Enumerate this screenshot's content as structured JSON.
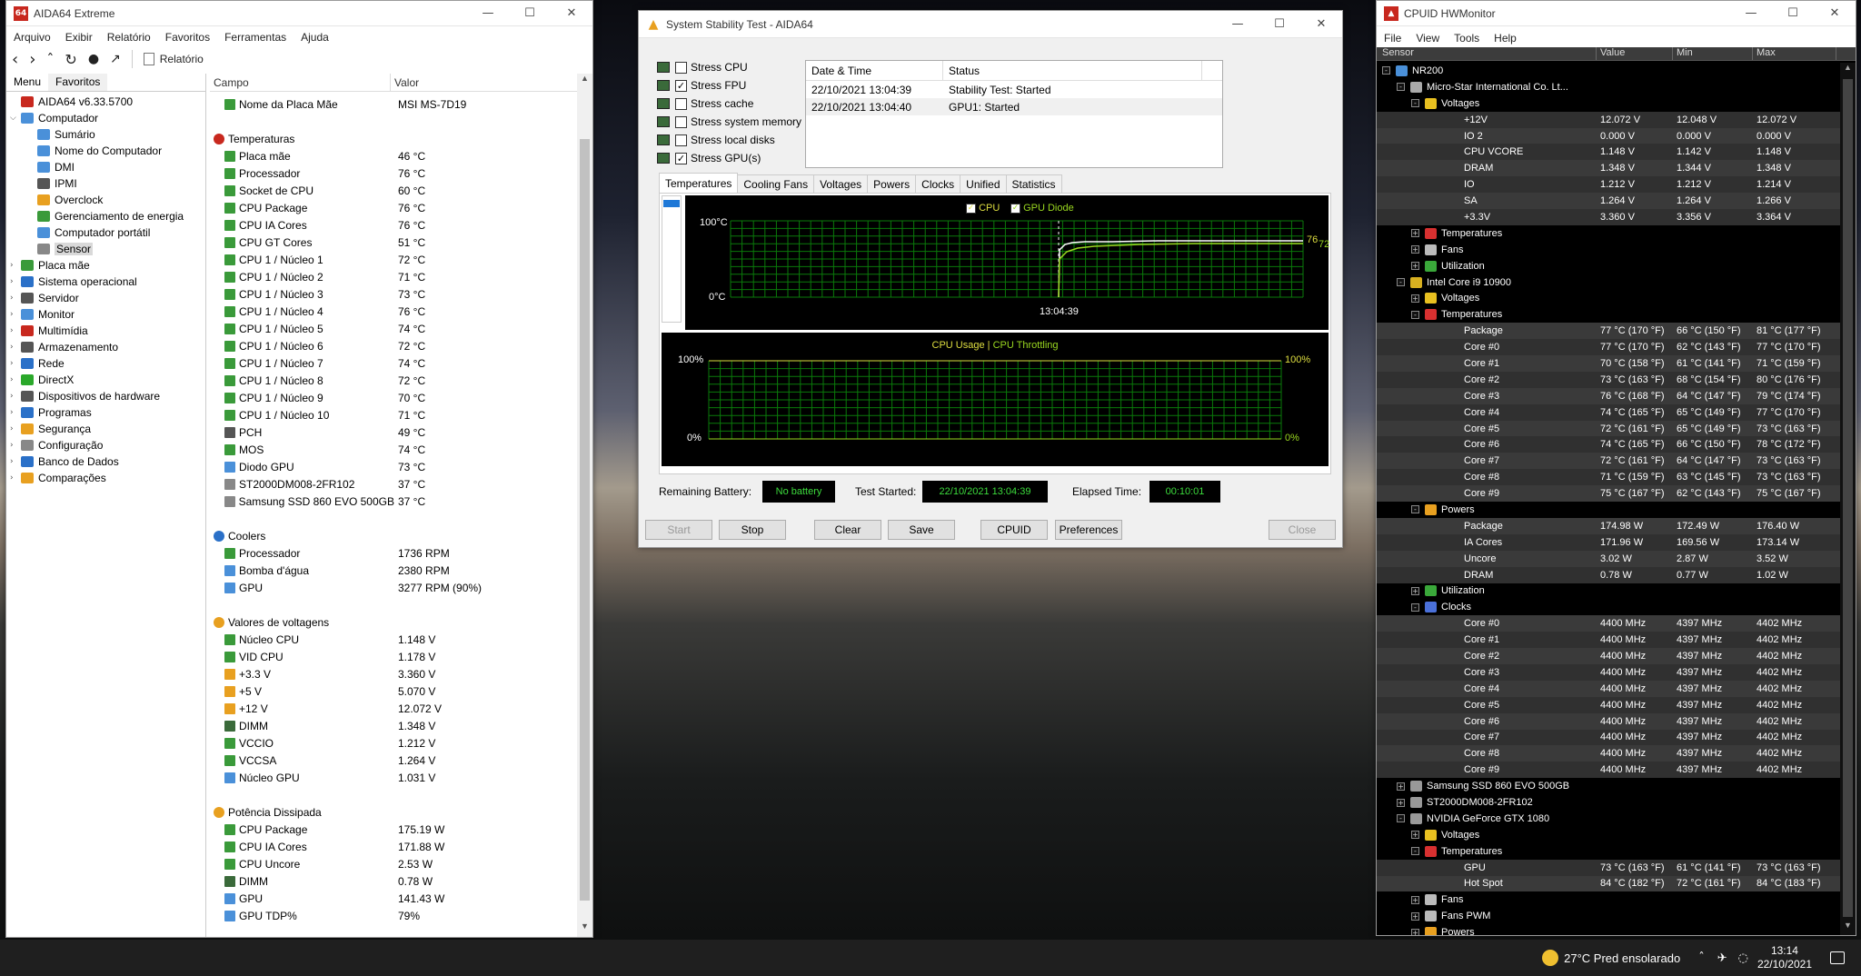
{
  "taskbar": {
    "weather": "27°C  Pred ensolarado",
    "time": "13:14",
    "date": "22/10/2021"
  },
  "aida": {
    "title": "AIDA64 Extreme",
    "menu": [
      "Arquivo",
      "Exibir",
      "Relatório",
      "Favoritos",
      "Ferramentas",
      "Ajuda"
    ],
    "report_label": "Relatório",
    "tabs": [
      "Menu",
      "Favoritos"
    ],
    "tree": [
      {
        "label": "AIDA64 v6.33.5700",
        "lvl": 0,
        "color": "#c8281e"
      },
      {
        "label": "Computador",
        "lvl": 0,
        "color": "#4a90d9",
        "exp": "v"
      },
      {
        "label": "Sumário",
        "lvl": 1,
        "color": "#4a90d9"
      },
      {
        "label": "Nome do Computador",
        "lvl": 1,
        "color": "#4a90d9"
      },
      {
        "label": "DMI",
        "lvl": 1,
        "color": "#4a90d9"
      },
      {
        "label": "IPMI",
        "lvl": 1,
        "color": "#555"
      },
      {
        "label": "Overclock",
        "lvl": 1,
        "color": "#e8a020"
      },
      {
        "label": "Gerenciamento de energia",
        "lvl": 1,
        "color": "#3a9a3a"
      },
      {
        "label": "Computador portátil",
        "lvl": 1,
        "color": "#4a90d9"
      },
      {
        "label": "Sensor",
        "lvl": 1,
        "color": "#888",
        "sel": true
      },
      {
        "label": "Placa mãe",
        "lvl": 0,
        "color": "#3a9a3a",
        "exp": ">"
      },
      {
        "label": "Sistema operacional",
        "lvl": 0,
        "color": "#2a70c8",
        "exp": ">"
      },
      {
        "label": "Servidor",
        "lvl": 0,
        "color": "#555",
        "exp": ">"
      },
      {
        "label": "Monitor",
        "lvl": 0,
        "color": "#4a90d9",
        "exp": ">"
      },
      {
        "label": "Multimídia",
        "lvl": 0,
        "color": "#c8281e",
        "exp": ">"
      },
      {
        "label": "Armazenamento",
        "lvl": 0,
        "color": "#555",
        "exp": ">"
      },
      {
        "label": "Rede",
        "lvl": 0,
        "color": "#2a70c8",
        "exp": ">"
      },
      {
        "label": "DirectX",
        "lvl": 0,
        "color": "#2aa82a",
        "exp": ">"
      },
      {
        "label": "Dispositivos de hardware",
        "lvl": 0,
        "color": "#555",
        "exp": ">"
      },
      {
        "label": "Programas",
        "lvl": 0,
        "color": "#2a70c8",
        "exp": ">"
      },
      {
        "label": "Segurança",
        "lvl": 0,
        "color": "#e8a020",
        "exp": ">"
      },
      {
        "label": "Configuração",
        "lvl": 0,
        "color": "#888",
        "exp": ">"
      },
      {
        "label": "Banco de Dados",
        "lvl": 0,
        "color": "#2a70c8",
        "exp": ">"
      },
      {
        "label": "Comparações",
        "lvl": 0,
        "color": "#e8a020",
        "exp": ">"
      }
    ],
    "cols": [
      "Campo",
      "Valor"
    ],
    "rows": [
      {
        "k": "Nome da Placa Mãe",
        "v": "MSI MS-7D19",
        "t": "i",
        "c": "#3a9a3a"
      },
      {
        "t": "b"
      },
      {
        "k": "Temperaturas",
        "t": "s",
        "c": "#c8281e"
      },
      {
        "k": "Placa mãe",
        "v": "46 °C",
        "t": "i",
        "c": "#3a9a3a"
      },
      {
        "k": "Processador",
        "v": "76 °C",
        "t": "i",
        "c": "#3a9a3a"
      },
      {
        "k": "Socket de CPU",
        "v": "60 °C",
        "t": "i",
        "c": "#3a9a3a"
      },
      {
        "k": "CPU Package",
        "v": "76 °C",
        "t": "i",
        "c": "#3a9a3a"
      },
      {
        "k": "CPU IA Cores",
        "v": "76 °C",
        "t": "i",
        "c": "#3a9a3a"
      },
      {
        "k": "CPU GT Cores",
        "v": "51 °C",
        "t": "i",
        "c": "#3a9a3a"
      },
      {
        "k": "CPU 1 / Núcleo 1",
        "v": "72 °C",
        "t": "i",
        "c": "#3a9a3a"
      },
      {
        "k": "CPU 1 / Núcleo 2",
        "v": "71 °C",
        "t": "i",
        "c": "#3a9a3a"
      },
      {
        "k": "CPU 1 / Núcleo 3",
        "v": "73 °C",
        "t": "i",
        "c": "#3a9a3a"
      },
      {
        "k": "CPU 1 / Núcleo 4",
        "v": "76 °C",
        "t": "i",
        "c": "#3a9a3a"
      },
      {
        "k": "CPU 1 / Núcleo 5",
        "v": "74 °C",
        "t": "i",
        "c": "#3a9a3a"
      },
      {
        "k": "CPU 1 / Núcleo 6",
        "v": "72 °C",
        "t": "i",
        "c": "#3a9a3a"
      },
      {
        "k": "CPU 1 / Núcleo 7",
        "v": "74 °C",
        "t": "i",
        "c": "#3a9a3a"
      },
      {
        "k": "CPU 1 / Núcleo 8",
        "v": "72 °C",
        "t": "i",
        "c": "#3a9a3a"
      },
      {
        "k": "CPU 1 / Núcleo 9",
        "v": "70 °C",
        "t": "i",
        "c": "#3a9a3a"
      },
      {
        "k": "CPU 1 / Núcleo 10",
        "v": "71 °C",
        "t": "i",
        "c": "#3a9a3a"
      },
      {
        "k": "PCH",
        "v": "49 °C",
        "t": "i",
        "c": "#555"
      },
      {
        "k": "MOS",
        "v": "74 °C",
        "t": "i",
        "c": "#3a9a3a"
      },
      {
        "k": "Diodo GPU",
        "v": "73 °C",
        "t": "i",
        "c": "#4a90d9"
      },
      {
        "k": "ST2000DM008-2FR102",
        "v": "37 °C",
        "t": "i",
        "c": "#888"
      },
      {
        "k": "Samsung SSD 860 EVO 500GB",
        "v": "37 °C",
        "t": "i",
        "c": "#888"
      },
      {
        "t": "b"
      },
      {
        "k": "Coolers",
        "t": "s",
        "c": "#2a70c8"
      },
      {
        "k": "Processador",
        "v": "1736 RPM",
        "t": "i",
        "c": "#3a9a3a"
      },
      {
        "k": "Bomba d'água",
        "v": "2380 RPM",
        "t": "i",
        "c": "#4a90d9"
      },
      {
        "k": "GPU",
        "v": "3277 RPM  (90%)",
        "t": "i",
        "c": "#4a90d9"
      },
      {
        "t": "b"
      },
      {
        "k": "Valores de voltagens",
        "t": "s",
        "c": "#e8a020"
      },
      {
        "k": "Núcleo CPU",
        "v": "1.148 V",
        "t": "i",
        "c": "#3a9a3a"
      },
      {
        "k": "VID CPU",
        "v": "1.178 V",
        "t": "i",
        "c": "#3a9a3a"
      },
      {
        "k": "+3.3 V",
        "v": "3.360 V",
        "t": "i",
        "c": "#e8a020"
      },
      {
        "k": "+5 V",
        "v": "5.070 V",
        "t": "i",
        "c": "#e8a020"
      },
      {
        "k": "+12 V",
        "v": "12.072 V",
        "t": "i",
        "c": "#e8a020"
      },
      {
        "k": "DIMM",
        "v": "1.348 V",
        "t": "i",
        "c": "#3a6a3a"
      },
      {
        "k": "VCCIO",
        "v": "1.212 V",
        "t": "i",
        "c": "#3a9a3a"
      },
      {
        "k": "VCCSA",
        "v": "1.264 V",
        "t": "i",
        "c": "#3a9a3a"
      },
      {
        "k": "Núcleo GPU",
        "v": "1.031 V",
        "t": "i",
        "c": "#4a90d9"
      },
      {
        "t": "b"
      },
      {
        "k": "Potência Dissipada",
        "t": "s",
        "c": "#e8a020"
      },
      {
        "k": "CPU Package",
        "v": "175.19 W",
        "t": "i",
        "c": "#3a9a3a"
      },
      {
        "k": "CPU IA Cores",
        "v": "171.88 W",
        "t": "i",
        "c": "#3a9a3a"
      },
      {
        "k": "CPU Uncore",
        "v": "2.53 W",
        "t": "i",
        "c": "#3a9a3a"
      },
      {
        "k": "DIMM",
        "v": "0.78 W",
        "t": "i",
        "c": "#3a6a3a"
      },
      {
        "k": "GPU",
        "v": "141.43 W",
        "t": "i",
        "c": "#4a90d9"
      },
      {
        "k": "GPU TDP%",
        "v": "79%",
        "t": "i",
        "c": "#4a90d9"
      }
    ]
  },
  "sst": {
    "title": "System Stability Test - AIDA64",
    "stress": [
      {
        "label": "Stress CPU",
        "checked": false
      },
      {
        "label": "Stress FPU",
        "checked": true
      },
      {
        "label": "Stress cache",
        "checked": false
      },
      {
        "label": "Stress system memory",
        "checked": false
      },
      {
        "label": "Stress local disks",
        "checked": false
      },
      {
        "label": "Stress GPU(s)",
        "checked": true
      }
    ],
    "log_cols": [
      "Date & Time",
      "Status"
    ],
    "log": [
      {
        "dt": "22/10/2021 13:04:39",
        "st": "Stability Test: Started"
      },
      {
        "dt": "22/10/2021 13:04:40",
        "st": "GPU1: Started"
      }
    ],
    "tabs": [
      "Temperatures",
      "Cooling Fans",
      "Voltages",
      "Powers",
      "Clocks",
      "Unified",
      "Statistics"
    ],
    "temp_graph": {
      "legend_cpu": "CPU",
      "legend_gpu": "GPU Diode",
      "ymax": "100°C",
      "ymin": "0°C",
      "time": "13:04:39",
      "val_cpu": "76",
      "val_gpu": "72"
    },
    "usage_graph": {
      "legend_usage": "CPU Usage",
      "sep": "|",
      "legend_thr": "CPU Throttling",
      "ymax": "100%",
      "ymin": "0%",
      "rmax": "100%",
      "rmin": "0%"
    },
    "status": {
      "battery_label": "Remaining Battery:",
      "battery": "No battery",
      "started_label": "Test Started:",
      "started": "22/10/2021 13:04:39",
      "elapsed_label": "Elapsed Time:",
      "elapsed": "00:10:01"
    },
    "buttons": [
      "Start",
      "Stop",
      "Clear",
      "Save",
      "CPUID",
      "Preferences",
      "Close"
    ]
  },
  "hwm": {
    "title": "CPUID HWMonitor",
    "menu": [
      "File",
      "View",
      "Tools",
      "Help"
    ],
    "cols": [
      "Sensor",
      "Value",
      "Min",
      "Max"
    ],
    "rows": [
      {
        "n": "NR200",
        "l": 0,
        "i": "pc",
        "e": "-"
      },
      {
        "n": "Micro-Star International Co. Lt...",
        "l": 1,
        "i": "mb",
        "e": "-"
      },
      {
        "n": "Voltages",
        "l": 2,
        "i": "volt",
        "e": "-"
      },
      {
        "n": "+12V",
        "l": 3,
        "v": "12.072 V",
        "mn": "12.048 V",
        "mx": "12.072 V",
        "d": true
      },
      {
        "n": "IO 2",
        "l": 3,
        "v": "0.000 V",
        "mn": "0.000 V",
        "mx": "0.000 V",
        "d": true
      },
      {
        "n": "CPU VCORE",
        "l": 3,
        "v": "1.148 V",
        "mn": "1.142 V",
        "mx": "1.148 V",
        "d": true
      },
      {
        "n": "DRAM",
        "l": 3,
        "v": "1.348 V",
        "mn": "1.344 V",
        "mx": "1.348 V",
        "d": true
      },
      {
        "n": "IO",
        "l": 3,
        "v": "1.212 V",
        "mn": "1.212 V",
        "mx": "1.214 V",
        "d": true
      },
      {
        "n": "SA",
        "l": 3,
        "v": "1.264 V",
        "mn": "1.264 V",
        "mx": "1.266 V",
        "d": true
      },
      {
        "n": "+3.3V",
        "l": 3,
        "v": "3.360 V",
        "mn": "3.356 V",
        "mx": "3.364 V",
        "d": true
      },
      {
        "n": "Temperatures",
        "l": 2,
        "i": "temp",
        "e": "+"
      },
      {
        "n": "Fans",
        "l": 2,
        "i": "fan",
        "e": "+"
      },
      {
        "n": "Utilization",
        "l": 2,
        "i": "util",
        "e": "+"
      },
      {
        "n": "Intel Core i9 10900",
        "l": 1,
        "i": "cpu",
        "e": "-"
      },
      {
        "n": "Voltages",
        "l": 2,
        "i": "volt",
        "e": "+"
      },
      {
        "n": "Temperatures",
        "l": 2,
        "i": "temp",
        "e": "-"
      },
      {
        "n": "Package",
        "l": 3,
        "v": "77 °C  (170 °F)",
        "mn": "66 °C  (150 °F)",
        "mx": "81 °C  (177 °F)",
        "d": true
      },
      {
        "n": "Core #0",
        "l": 3,
        "v": "77 °C  (170 °F)",
        "mn": "62 °C  (143 °F)",
        "mx": "77 °C  (170 °F)",
        "d": true
      },
      {
        "n": "Core #1",
        "l": 3,
        "v": "70 °C  (158 °F)",
        "mn": "61 °C  (141 °F)",
        "mx": "71 °C  (159 °F)",
        "d": true
      },
      {
        "n": "Core #2",
        "l": 3,
        "v": "73 °C  (163 °F)",
        "mn": "68 °C  (154 °F)",
        "mx": "80 °C  (176 °F)",
        "d": true
      },
      {
        "n": "Core #3",
        "l": 3,
        "v": "76 °C  (168 °F)",
        "mn": "64 °C  (147 °F)",
        "mx": "79 °C  (174 °F)",
        "d": true
      },
      {
        "n": "Core #4",
        "l": 3,
        "v": "74 °C  (165 °F)",
        "mn": "65 °C  (149 °F)",
        "mx": "77 °C  (170 °F)",
        "d": true
      },
      {
        "n": "Core #5",
        "l": 3,
        "v": "72 °C  (161 °F)",
        "mn": "65 °C  (149 °F)",
        "mx": "73 °C  (163 °F)",
        "d": true
      },
      {
        "n": "Core #6",
        "l": 3,
        "v": "74 °C  (165 °F)",
        "mn": "66 °C  (150 °F)",
        "mx": "78 °C  (172 °F)",
        "d": true
      },
      {
        "n": "Core #7",
        "l": 3,
        "v": "72 °C  (161 °F)",
        "mn": "64 °C  (147 °F)",
        "mx": "73 °C  (163 °F)",
        "d": true
      },
      {
        "n": "Core #8",
        "l": 3,
        "v": "71 °C  (159 °F)",
        "mn": "63 °C  (145 °F)",
        "mx": "73 °C  (163 °F)",
        "d": true
      },
      {
        "n": "Core #9",
        "l": 3,
        "v": "75 °C  (167 °F)",
        "mn": "62 °C  (143 °F)",
        "mx": "75 °C  (167 °F)",
        "d": true
      },
      {
        "n": "Powers",
        "l": 2,
        "i": "pow",
        "e": "-"
      },
      {
        "n": "Package",
        "l": 3,
        "v": "174.98 W",
        "mn": "172.49 W",
        "mx": "176.40 W",
        "d": true
      },
      {
        "n": "IA Cores",
        "l": 3,
        "v": "171.96 W",
        "mn": "169.56 W",
        "mx": "173.14 W",
        "d": true
      },
      {
        "n": "Uncore",
        "l": 3,
        "v": "3.02 W",
        "mn": "2.87 W",
        "mx": "3.52 W",
        "d": true
      },
      {
        "n": "DRAM",
        "l": 3,
        "v": "0.78 W",
        "mn": "0.77 W",
        "mx": "1.02 W",
        "d": true
      },
      {
        "n": "Utilization",
        "l": 2,
        "i": "util",
        "e": "+"
      },
      {
        "n": "Clocks",
        "l": 2,
        "i": "clk",
        "e": "-"
      },
      {
        "n": "Core #0",
        "l": 3,
        "v": "4400 MHz",
        "mn": "4397 MHz",
        "mx": "4402 MHz",
        "d": true
      },
      {
        "n": "Core #1",
        "l": 3,
        "v": "4400 MHz",
        "mn": "4397 MHz",
        "mx": "4402 MHz",
        "d": true
      },
      {
        "n": "Core #2",
        "l": 3,
        "v": "4400 MHz",
        "mn": "4397 MHz",
        "mx": "4402 MHz",
        "d": true
      },
      {
        "n": "Core #3",
        "l": 3,
        "v": "4400 MHz",
        "mn": "4397 MHz",
        "mx": "4402 MHz",
        "d": true
      },
      {
        "n": "Core #4",
        "l": 3,
        "v": "4400 MHz",
        "mn": "4397 MHz",
        "mx": "4402 MHz",
        "d": true
      },
      {
        "n": "Core #5",
        "l": 3,
        "v": "4400 MHz",
        "mn": "4397 MHz",
        "mx": "4402 MHz",
        "d": true
      },
      {
        "n": "Core #6",
        "l": 3,
        "v": "4400 MHz",
        "mn": "4397 MHz",
        "mx": "4402 MHz",
        "d": true
      },
      {
        "n": "Core #7",
        "l": 3,
        "v": "4400 MHz",
        "mn": "4397 MHz",
        "mx": "4402 MHz",
        "d": true
      },
      {
        "n": "Core #8",
        "l": 3,
        "v": "4400 MHz",
        "mn": "4397 MHz",
        "mx": "4402 MHz",
        "d": true
      },
      {
        "n": "Core #9",
        "l": 3,
        "v": "4400 MHz",
        "mn": "4397 MHz",
        "mx": "4402 MHz",
        "d": true
      },
      {
        "n": "Samsung SSD 860 EVO 500GB",
        "l": 1,
        "i": "disk",
        "e": "+"
      },
      {
        "n": "ST2000DM008-2FR102",
        "l": 1,
        "i": "disk",
        "e": "+"
      },
      {
        "n": "NVIDIA GeForce GTX 1080",
        "l": 1,
        "i": "gpu",
        "e": "-"
      },
      {
        "n": "Voltages",
        "l": 2,
        "i": "volt",
        "e": "+"
      },
      {
        "n": "Temperatures",
        "l": 2,
        "i": "temp",
        "e": "-"
      },
      {
        "n": "GPU",
        "l": 3,
        "v": "73 °C  (163 °F)",
        "mn": "61 °C  (141 °F)",
        "mx": "73 °C  (163 °F)",
        "d": true
      },
      {
        "n": "Hot Spot",
        "l": 3,
        "v": "84 °C  (182 °F)",
        "mn": "72 °C  (161 °F)",
        "mx": "84 °C  (183 °F)",
        "d": true
      },
      {
        "n": "Fans",
        "l": 2,
        "i": "fan",
        "e": "+"
      },
      {
        "n": "Fans PWM",
        "l": 2,
        "i": "fan",
        "e": "+"
      },
      {
        "n": "Powers",
        "l": 2,
        "i": "pow",
        "e": "+"
      }
    ]
  }
}
